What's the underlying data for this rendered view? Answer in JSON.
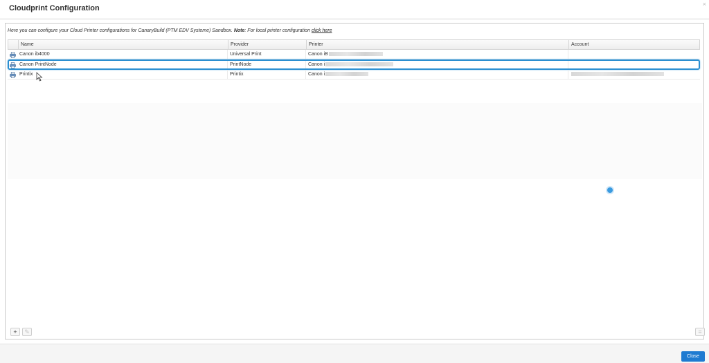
{
  "dialog": {
    "title": "Cloudprint Configuration",
    "close_glyph": "×",
    "close_button_label": "Close"
  },
  "intro": {
    "text_before": "Here you can configure your Cloud Printer configurations for CanaryBuild (PTM EDV Systeme) Sandbox. ",
    "note_label": "Note",
    "text_after": ": For local printer configuration ",
    "link_text": "click here"
  },
  "grid": {
    "columns": [
      "Name",
      "Provider",
      "Printer",
      "Account"
    ],
    "rows": [
      {
        "name": "Canon ib4000",
        "provider": "Universal Print",
        "printer": "Canon iB",
        "account": "",
        "selected": false
      },
      {
        "name": "Canon PrintNode",
        "provider": "PrintNode",
        "printer": "Canon i",
        "account": "",
        "selected": true
      },
      {
        "name": "Printix",
        "provider": "Printix",
        "printer": "Canon i",
        "account": "",
        "selected": false
      }
    ]
  },
  "footer": {
    "add_glyph": "+",
    "edit_glyph": "✎",
    "menu_glyph": "≡"
  },
  "colors": {
    "accent": "#1f7bd1",
    "selection_border": "#2b8fd1"
  },
  "icons": [
    "printer-icon",
    "add-icon",
    "edit-icon",
    "menu-icon",
    "close-icon"
  ]
}
